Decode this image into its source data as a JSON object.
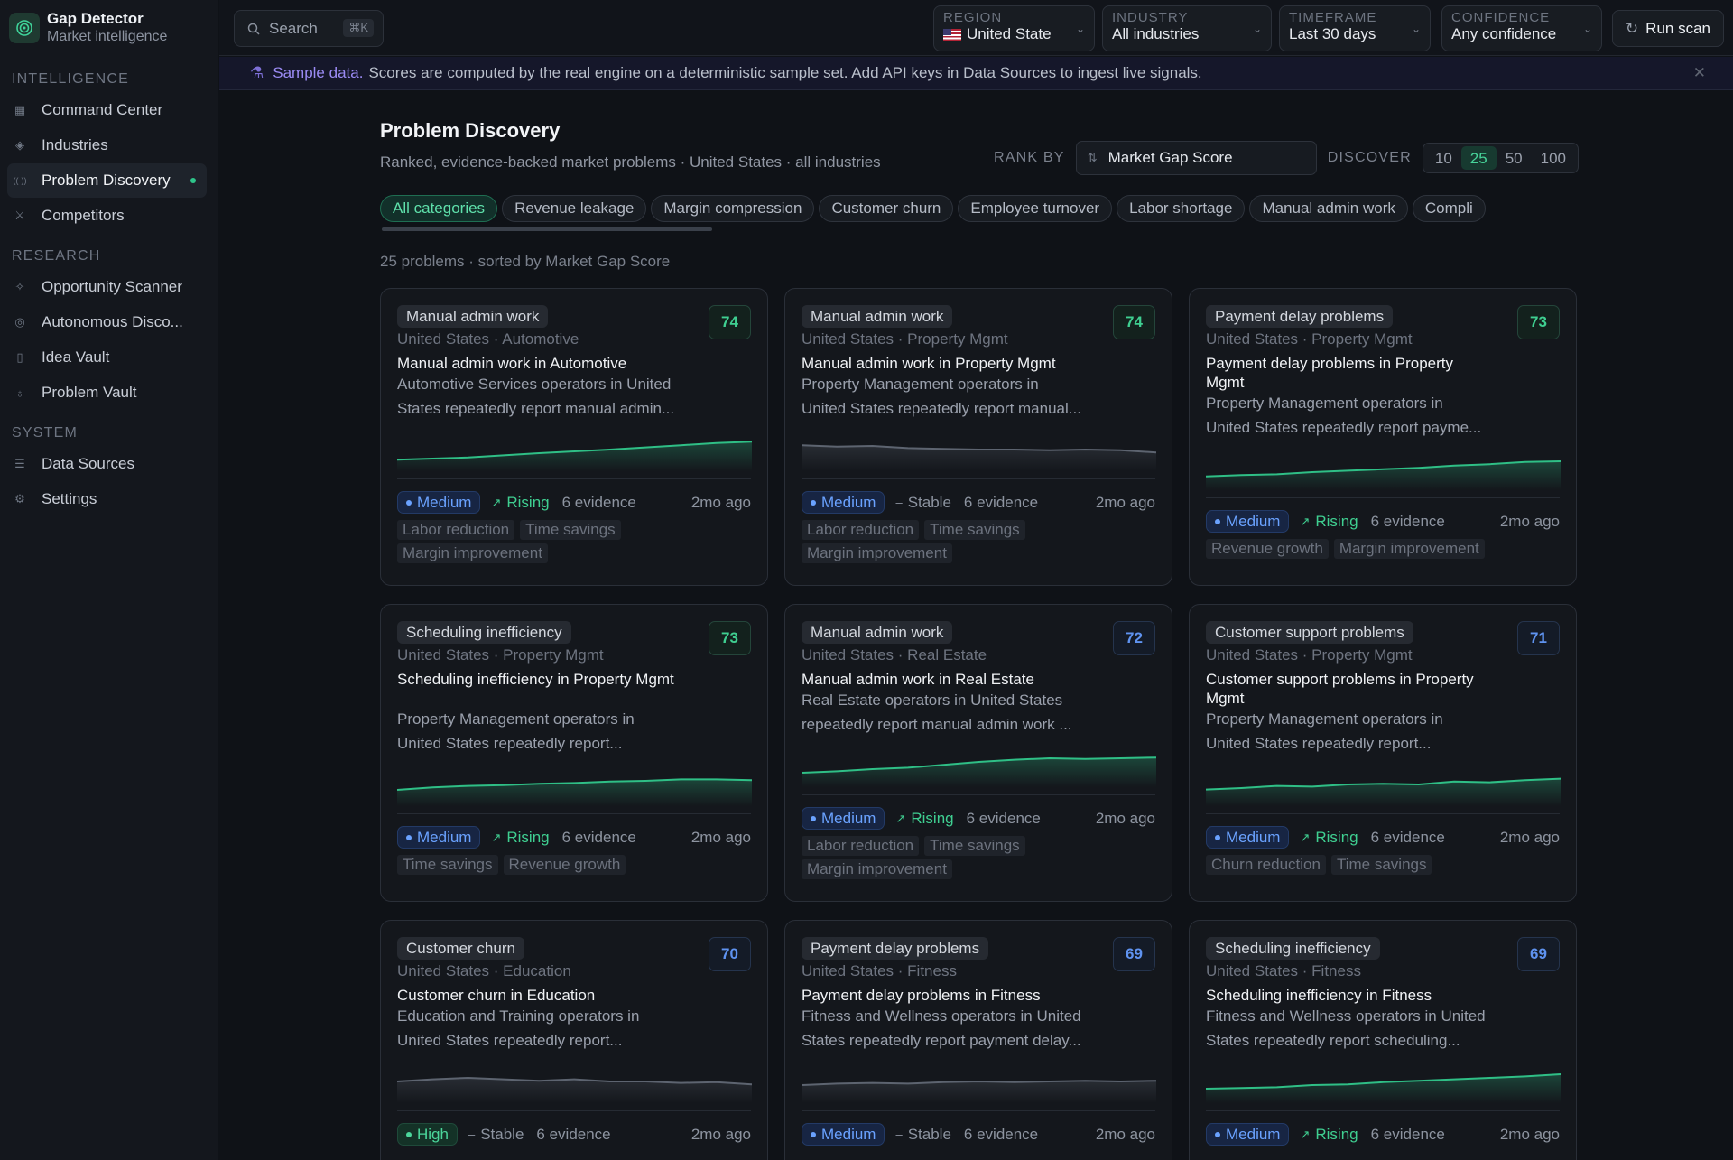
{
  "app": {
    "name": "Gap Detector",
    "tagline": "Market intelligence"
  },
  "search": {
    "placeholder": "Search",
    "shortcut": "⌘K"
  },
  "filters": {
    "region": {
      "label": "REGION",
      "value": "United State"
    },
    "industry": {
      "label": "INDUSTRY",
      "value": "All industries"
    },
    "timeframe": {
      "label": "TIMEFRAME",
      "value": "Last 30 days"
    },
    "confidence": {
      "label": "CONFIDENCE",
      "value": "Any confidence"
    }
  },
  "run_scan": "Run scan",
  "sidebar": {
    "sections": [
      {
        "title": "INTELLIGENCE",
        "items": [
          {
            "label": "Command Center",
            "icon": "grid-icon"
          },
          {
            "label": "Industries",
            "icon": "cube-icon"
          },
          {
            "label": "Problem Discovery",
            "icon": "radio-waves-icon",
            "active": true
          },
          {
            "label": "Competitors",
            "icon": "swords-icon"
          }
        ]
      },
      {
        "title": "RESEARCH",
        "items": [
          {
            "label": "Opportunity Scanner",
            "icon": "sparkle-icon"
          },
          {
            "label": "Autonomous Disco...",
            "icon": "radar-icon"
          },
          {
            "label": "Idea Vault",
            "icon": "bookmark-icon"
          },
          {
            "label": "Problem Vault",
            "icon": "lightbulb-icon"
          }
        ]
      },
      {
        "title": "SYSTEM",
        "items": [
          {
            "label": "Data Sources",
            "icon": "database-icon"
          },
          {
            "label": "Settings",
            "icon": "gear-icon"
          }
        ]
      }
    ]
  },
  "banner": {
    "highlight": "Sample data.",
    "text": "Scores are computed by the real engine on a deterministic sample set. Add API keys in Data Sources to ingest live signals."
  },
  "page": {
    "title": "Problem Discovery",
    "subtitle": "Ranked, evidence-backed market problems · United States · all industries",
    "rank_by_label": "RANK BY",
    "rank_by_value": "Market Gap Score",
    "discover_label": "DISCOVER",
    "discover_options": [
      "10",
      "25",
      "50",
      "100"
    ],
    "discover_selected": "25",
    "categories": [
      "All categories",
      "Revenue leakage",
      "Margin compression",
      "Customer churn",
      "Employee turnover",
      "Labor shortage",
      "Manual admin work",
      "Compli"
    ],
    "count_text": "25 problems · sorted by Market Gap Score"
  },
  "cards": [
    {
      "category": "Manual admin work",
      "score": "74",
      "score_color": "green",
      "location": "United States · Automotive",
      "title": "Manual admin work in Automotive",
      "desc": [
        "Automotive Services operators in United",
        "States repeatedly report manual admin..."
      ],
      "confidence": "Medium",
      "trend": "Rising",
      "evidence": "6 evidence",
      "ago": "2mo ago",
      "tags": [
        "Labor reduction",
        "Time savings",
        "Margin improvement"
      ],
      "spark": [
        0.32,
        0.35,
        0.38,
        0.44,
        0.5,
        0.55,
        0.6,
        0.66,
        0.72,
        0.78,
        0.82
      ]
    },
    {
      "category": "Manual admin work",
      "score": "74",
      "score_color": "green",
      "location": "United States · Property Mgmt",
      "title": "Manual admin work in Property Mgmt",
      "desc": [
        "Property Management operators in",
        "United States repeatedly report manual..."
      ],
      "confidence": "Medium",
      "trend": "Stable",
      "evidence": "6 evidence",
      "ago": "2mo ago",
      "tags": [
        "Labor reduction",
        "Time savings",
        "Margin improvement"
      ],
      "spark": [
        0.72,
        0.68,
        0.7,
        0.64,
        0.62,
        0.6,
        0.6,
        0.58,
        0.6,
        0.58,
        0.52
      ]
    },
    {
      "category": "Payment delay problems",
      "score": "73",
      "score_color": "green",
      "location": "United States · Property Mgmt",
      "title": "Payment delay problems in Property Mgmt",
      "desc": [
        "Property Management operators in",
        "United States repeatedly report payme..."
      ],
      "confidence": "Medium",
      "trend": "Rising",
      "evidence": "6 evidence",
      "ago": "2mo ago",
      "tags": [
        "Revenue growth",
        "Margin improvement"
      ],
      "spark": [
        0.38,
        0.42,
        0.44,
        0.5,
        0.54,
        0.58,
        0.62,
        0.68,
        0.72,
        0.78,
        0.8
      ]
    },
    {
      "category": "Scheduling inefficiency",
      "score": "73",
      "score_color": "green",
      "location": "United States · Property Mgmt",
      "title": "Scheduling inefficiency in Property Mgmt",
      "desc": [
        "Property Management operators in",
        "United States repeatedly report..."
      ],
      "confidence": "Medium",
      "trend": "Rising",
      "evidence": "6 evidence",
      "ago": "2mo ago",
      "tags": [
        "Time savings",
        "Revenue growth"
      ],
      "spark": [
        0.45,
        0.52,
        0.56,
        0.58,
        0.62,
        0.64,
        0.68,
        0.7,
        0.74,
        0.74,
        0.72
      ]
    },
    {
      "category": "Manual admin work",
      "score": "72",
      "score_color": "blue",
      "location": "United States · Real Estate",
      "title": "Manual admin work in Real Estate",
      "desc": [
        "Real Estate operators in United States",
        "repeatedly report manual admin work ..."
      ],
      "confidence": "Medium",
      "trend": "Rising",
      "evidence": "6 evidence",
      "ago": "2mo ago",
      "tags": [
        "Labor reduction",
        "Time savings",
        "Margin improvement"
      ],
      "spark": [
        0.4,
        0.44,
        0.5,
        0.54,
        0.62,
        0.7,
        0.76,
        0.8,
        0.78,
        0.8,
        0.82
      ]
    },
    {
      "category": "Customer support problems",
      "score": "71",
      "score_color": "blue",
      "location": "United States · Property Mgmt",
      "title": "Customer support problems in Property Mgmt",
      "desc": [
        "Property Management operators in",
        "United States repeatedly report..."
      ],
      "confidence": "Medium",
      "trend": "Rising",
      "evidence": "6 evidence",
      "ago": "2mo ago",
      "tags": [
        "Churn reduction",
        "Time savings"
      ],
      "spark": [
        0.46,
        0.5,
        0.56,
        0.54,
        0.6,
        0.62,
        0.6,
        0.68,
        0.66,
        0.72,
        0.76
      ]
    },
    {
      "category": "Customer churn",
      "score": "70",
      "score_color": "blue",
      "location": "United States · Education",
      "title": "Customer churn in Education",
      "desc": [
        "Education and Training operators in",
        "United States repeatedly report..."
      ],
      "confidence": "High",
      "trend": "Stable",
      "evidence": "6 evidence",
      "ago": "2mo ago",
      "tags": [],
      "spark": [
        0.6,
        0.66,
        0.7,
        0.66,
        0.62,
        0.66,
        0.6,
        0.6,
        0.56,
        0.58,
        0.52
      ]
    },
    {
      "category": "Payment delay problems",
      "score": "69",
      "score_color": "blue",
      "location": "United States · Fitness",
      "title": "Payment delay problems in Fitness",
      "desc": [
        "Fitness and Wellness operators in United",
        "States repeatedly report payment delay..."
      ],
      "confidence": "Medium",
      "trend": "Stable",
      "evidence": "6 evidence",
      "ago": "2mo ago",
      "tags": [],
      "spark": [
        0.5,
        0.54,
        0.56,
        0.54,
        0.58,
        0.6,
        0.58,
        0.6,
        0.62,
        0.6,
        0.62
      ]
    },
    {
      "category": "Scheduling inefficiency",
      "score": "69",
      "score_color": "blue",
      "location": "United States · Fitness",
      "title": "Scheduling inefficiency in Fitness",
      "desc": [
        "Fitness and Wellness operators in United",
        "States repeatedly report scheduling..."
      ],
      "confidence": "Medium",
      "trend": "Rising",
      "evidence": "6 evidence",
      "ago": "2mo ago",
      "tags": [],
      "spark": [
        0.4,
        0.42,
        0.44,
        0.5,
        0.52,
        0.58,
        0.62,
        0.66,
        0.7,
        0.74,
        0.8
      ]
    }
  ]
}
